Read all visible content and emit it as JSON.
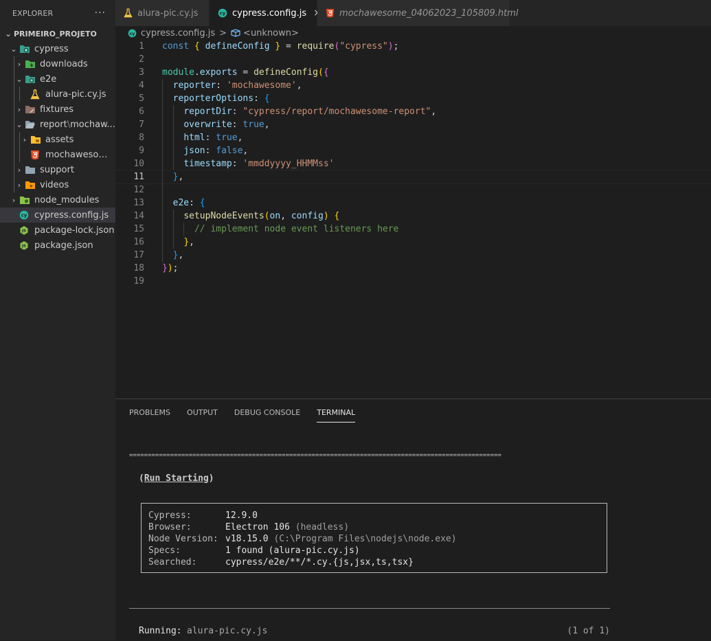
{
  "sidebar": {
    "title": "EXPLORER",
    "more": "···",
    "project": "PRIMEIRO_PROJETO",
    "items": [
      {
        "label": "cypress",
        "chev": "⌄"
      },
      {
        "label": "downloads",
        "chev": "›"
      },
      {
        "label": "e2e",
        "chev": "⌄"
      },
      {
        "label": "alura-pic.cy.js",
        "chev": ""
      },
      {
        "label": "fixtures",
        "chev": "›"
      },
      {
        "label": "report",
        "sub": "mochaw...",
        "chev": "⌄"
      },
      {
        "label": "assets",
        "chev": "›"
      },
      {
        "label": "mochawesome...",
        "chev": ""
      },
      {
        "label": "support",
        "chev": "›"
      },
      {
        "label": "videos",
        "chev": "›"
      },
      {
        "label": "node_modules",
        "chev": "›"
      },
      {
        "label": "cypress.config.js",
        "chev": ""
      },
      {
        "label": "package-lock.json",
        "chev": ""
      },
      {
        "label": "package.json",
        "chev": ""
      }
    ]
  },
  "tabs": [
    {
      "label": "alura-pic.cy.js"
    },
    {
      "label": "cypress.config.js",
      "close": "×"
    },
    {
      "label": "mochawesome_04062023_105809.html"
    }
  ],
  "breadcrumb": {
    "file": "cypress.config.js",
    "sep": ">",
    "symbol": "<unknown>"
  },
  "editor": {
    "line_numbers": [
      "1",
      "2",
      "3",
      "4",
      "5",
      "6",
      "7",
      "8",
      "9",
      "10",
      "11",
      "12",
      "13",
      "14",
      "15",
      "16",
      "17",
      "18",
      "19"
    ],
    "lines": [
      [
        [
          "kw",
          "const"
        ],
        [
          "pl",
          " "
        ],
        [
          "br1",
          "{"
        ],
        [
          "pl",
          " "
        ],
        [
          "var",
          "defineConfig"
        ],
        [
          "pl",
          " "
        ],
        [
          "br1",
          "}"
        ],
        [
          "pl",
          " = "
        ],
        [
          "fn",
          "require"
        ],
        [
          "br2",
          "("
        ],
        [
          "str",
          "\"cypress\""
        ],
        [
          "br2",
          ")"
        ],
        [
          "pl",
          ";"
        ]
      ],
      [],
      [
        [
          "cls",
          "module"
        ],
        [
          "pl",
          "."
        ],
        [
          "var",
          "exports"
        ],
        [
          "pl",
          " = "
        ],
        [
          "fn",
          "defineConfig"
        ],
        [
          "br1",
          "("
        ],
        [
          "br2",
          "{"
        ]
      ],
      [
        [
          "pl",
          "  "
        ],
        [
          "var",
          "reporter"
        ],
        [
          "pl",
          ": "
        ],
        [
          "str",
          "'mochawesome'"
        ],
        [
          "pl",
          ","
        ]
      ],
      [
        [
          "pl",
          "  "
        ],
        [
          "var",
          "reporterOptions"
        ],
        [
          "pl",
          ": "
        ],
        [
          "br3",
          "{"
        ]
      ],
      [
        [
          "pl",
          "    "
        ],
        [
          "var",
          "reportDir"
        ],
        [
          "pl",
          ": "
        ],
        [
          "str",
          "\"cypress/report/mochawesome-report\""
        ],
        [
          "pl",
          ","
        ]
      ],
      [
        [
          "pl",
          "    "
        ],
        [
          "var",
          "overwrite"
        ],
        [
          "pl",
          ": "
        ],
        [
          "kw",
          "true"
        ],
        [
          "pl",
          ","
        ]
      ],
      [
        [
          "pl",
          "    "
        ],
        [
          "var",
          "html"
        ],
        [
          "pl",
          ": "
        ],
        [
          "kw",
          "true"
        ],
        [
          "pl",
          ","
        ]
      ],
      [
        [
          "pl",
          "    "
        ],
        [
          "var",
          "json"
        ],
        [
          "pl",
          ": "
        ],
        [
          "kw",
          "false"
        ],
        [
          "pl",
          ","
        ]
      ],
      [
        [
          "pl",
          "    "
        ],
        [
          "var",
          "timestamp"
        ],
        [
          "pl",
          ": "
        ],
        [
          "str",
          "'mmddyyyy_HHMMss'"
        ]
      ],
      [
        [
          "pl",
          "  "
        ],
        [
          "br3",
          "}"
        ],
        [
          "pl",
          ","
        ]
      ],
      [],
      [
        [
          "pl",
          "  "
        ],
        [
          "var",
          "e2e"
        ],
        [
          "pl",
          ": "
        ],
        [
          "br3",
          "{"
        ]
      ],
      [
        [
          "pl",
          "    "
        ],
        [
          "fn",
          "setupNodeEvents"
        ],
        [
          "br1",
          "("
        ],
        [
          "var",
          "on"
        ],
        [
          "pl",
          ", "
        ],
        [
          "var",
          "config"
        ],
        [
          "br1",
          ")"
        ],
        [
          "pl",
          " "
        ],
        [
          "br1",
          "{"
        ]
      ],
      [
        [
          "pl",
          "      "
        ],
        [
          "cm",
          "// implement node event listeners here"
        ]
      ],
      [
        [
          "pl",
          "    "
        ],
        [
          "br1",
          "}"
        ],
        [
          "pl",
          ","
        ]
      ],
      [
        [
          "pl",
          "  "
        ],
        [
          "br3",
          "}"
        ],
        [
          "pl",
          ","
        ]
      ],
      [
        [
          "br2",
          "}"
        ],
        [
          "br1",
          ")"
        ],
        [
          "pl",
          ";"
        ]
      ],
      []
    ]
  },
  "panel": {
    "tabs": [
      "PROBLEMS",
      "OUTPUT",
      "DEBUG CONSOLE",
      "TERMINAL"
    ],
    "terminal": {
      "separator": "====================================================================================================",
      "run_starting": "Run Starting",
      "info": [
        {
          "key": "Cypress:",
          "value": "12.9.0",
          "extra": ""
        },
        {
          "key": "Browser:",
          "value": "Electron 106",
          "extra": "(headless)"
        },
        {
          "key": "Node Version:",
          "value": "v18.15.0",
          "extra": "(C:\\Program Files\\nodejs\\node.exe)"
        },
        {
          "key": "Specs:",
          "value": "1 found (alura-pic.cy.js)",
          "extra": ""
        },
        {
          "key": "Searched:",
          "value": "cypress/e2e/**/*.cy.{js,jsx,ts,tsx}",
          "extra": ""
        }
      ],
      "running_label": "Running:",
      "running_file": "alura-pic.cy.js",
      "running_count": "(1 of 1)"
    }
  },
  "colors": {
    "cypress_icon": "#27b8a0",
    "folder": "#90a4ae",
    "js": "#f5c542",
    "html": "#e44d26",
    "node": "#8bc34a"
  }
}
